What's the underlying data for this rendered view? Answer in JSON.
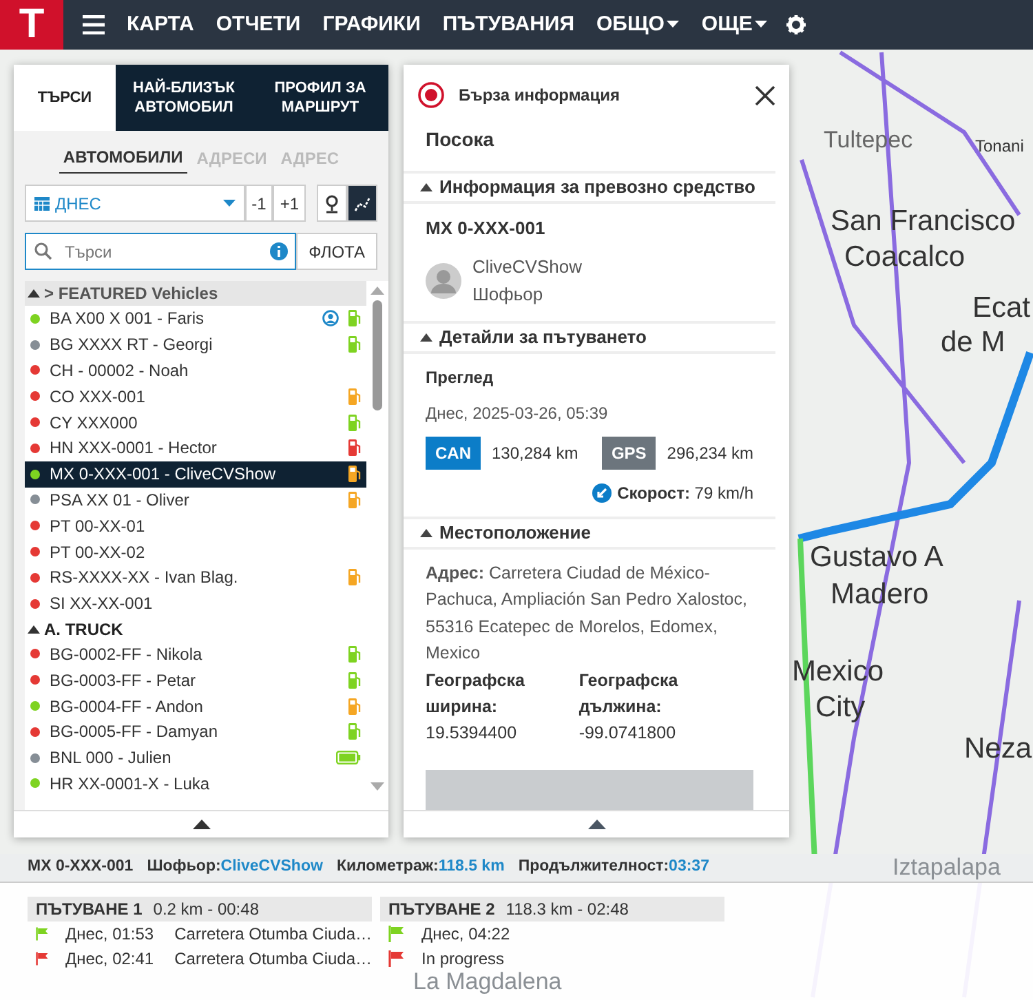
{
  "navbar": {
    "logo": "T",
    "menu": [
      {
        "label": "КАРТА",
        "dropdown": false
      },
      {
        "label": "ОТЧЕТИ",
        "dropdown": false
      },
      {
        "label": "ГРАФИКИ",
        "dropdown": false
      },
      {
        "label": "ПЪТУВАНИЯ",
        "dropdown": false
      },
      {
        "label": "ОБЩО",
        "dropdown": true
      },
      {
        "label": "ОЩЕ",
        "dropdown": true
      }
    ]
  },
  "map": {
    "labels": [
      "Tultepec",
      "Tonani",
      "San Francisco",
      "Coacalco",
      "Ecat",
      "de M",
      "Gustavo A",
      "Madero",
      "Mexico",
      "City",
      "Neza",
      "Iztapalapa",
      "La Magdalena"
    ]
  },
  "left_panel": {
    "tabs": [
      {
        "label": "ТЪРСИ",
        "selected": true
      },
      {
        "label": "НАЙ-БЛИЗЪК АВТОМОБИЛ",
        "selected": false
      },
      {
        "label": "ПРОФИЛ ЗА МАРШРУТ",
        "selected": false
      }
    ],
    "subtabs": [
      {
        "label": "АВТОМОБИЛИ",
        "selected": true
      },
      {
        "label": "АДРЕСИ",
        "selected": false
      },
      {
        "label": "АДРЕС",
        "selected": false
      }
    ],
    "date": {
      "value": "ДНЕС",
      "minus": "-1",
      "plus": "+1"
    },
    "route_toggle": {
      "on": true
    },
    "search": {
      "placeholder": "Търси",
      "fleet_button": "ФЛОТА"
    },
    "groups": [
      {
        "title": "> FEATURED Vehicles",
        "expanded": true,
        "vehicles": [
          {
            "name": "BA X00 X 001 - Faris",
            "color": "#7ed321",
            "selected": false,
            "badges": [
              {
                "kind": "driver",
                "color": "#1e88c8"
              },
              {
                "kind": "fuel",
                "color": "#7ed321"
              }
            ]
          },
          {
            "name": "BG XXXX RT - Georgi",
            "color": "#868e96",
            "selected": false,
            "badges": [
              {
                "kind": "fuel",
                "color": "#7ed321"
              }
            ]
          },
          {
            "name": "CH - 00002 - Noah",
            "color": "#e53935",
            "selected": false
          },
          {
            "name": "CO XXX-001",
            "color": "#e53935",
            "selected": false,
            "badges": [
              {
                "kind": "fuel",
                "color": "#f5a623"
              }
            ]
          },
          {
            "name": "CY XXX000",
            "color": "#e53935",
            "selected": false,
            "badges": [
              {
                "kind": "fuel",
                "color": "#7ed321"
              }
            ]
          },
          {
            "name": "HN XXX-0001 - Hector",
            "color": "#e53935",
            "selected": false,
            "badges": [
              {
                "kind": "fuel",
                "color": "#e53935"
              }
            ]
          },
          {
            "name": "MX 0-XXX-001 - CliveCVShow",
            "color": "#7ed321",
            "selected": true,
            "badges": [
              {
                "kind": "fuel",
                "color": "#f5a623"
              }
            ]
          },
          {
            "name": "PSA XX 01 - Oliver",
            "color": "#868e96",
            "selected": false,
            "badges": [
              {
                "kind": "fuel",
                "color": "#f5a623"
              }
            ]
          },
          {
            "name": "PT 00-XX-01",
            "color": "#e53935",
            "selected": false
          },
          {
            "name": "PT 00-XX-02",
            "color": "#e53935",
            "selected": false
          },
          {
            "name": "RS-XXXX-XX - Ivan Blag.",
            "color": "#e53935",
            "selected": false,
            "badges": [
              {
                "kind": "fuel",
                "color": "#f5a623"
              }
            ]
          },
          {
            "name": "SI XX-XX-001",
            "color": "#e53935",
            "selected": false
          }
        ]
      },
      {
        "title": "A. TRUCK",
        "expanded": true,
        "vehicles": [
          {
            "name": "BG-0002-FF - Nikola",
            "color": "#e53935",
            "selected": false,
            "badges": [
              {
                "kind": "fuel",
                "color": "#7ed321"
              }
            ]
          },
          {
            "name": "BG-0003-FF - Petar",
            "color": "#e53935",
            "selected": false,
            "badges": [
              {
                "kind": "fuel",
                "color": "#7ed321"
              }
            ]
          },
          {
            "name": "BG-0004-FF - Andon",
            "color": "#7ed321",
            "selected": false,
            "badges": [
              {
                "kind": "fuel",
                "color": "#f5a623"
              }
            ]
          },
          {
            "name": "BG-0005-FF - Damyan",
            "color": "#e53935",
            "selected": false,
            "badges": [
              {
                "kind": "fuel",
                "color": "#7ed321"
              }
            ]
          },
          {
            "name": "BNL 000 - Julien",
            "color": "#868e96",
            "selected": false,
            "badges": [
              {
                "kind": "battery",
                "color": "#7ed321"
              }
            ]
          },
          {
            "name": "HR XX-0001-X - Luka",
            "color": "#7ed321",
            "selected": false
          }
        ]
      }
    ]
  },
  "info_panel": {
    "title": "Бърза информация",
    "direction": "Посока",
    "vehicle_section": {
      "title": "Информация за превозно средство",
      "expanded": true,
      "plate": "MX 0-XXX-001",
      "driver": "CliveCVShow",
      "role": "Шофьор"
    },
    "trip_section": {
      "title": "Детайли за пътуването",
      "expanded": true,
      "overview": "Преглед",
      "date": "Днес, 2025-03-26, 05:39",
      "can_label": "CAN",
      "can_value": "130,284 km",
      "gps_label": "GPS",
      "gps_value": "296,234 km",
      "speed": "**Скорост:** 79 km/h"
    },
    "location_section": {
      "title": "Местоположение",
      "expanded": true,
      "address": "**Адрес:** Carretera Ciudad de México-Pachuca, Ampliación San Pedro Xalostoc, 55316 Ecatepec de Morelos, Edomex, Mexico",
      "lat_label": "Географска ширина:",
      "lat": "19.5394400",
      "lon_label": "Географска дължина:",
      "lon": "-99.0741800"
    }
  },
  "status_bar": {
    "plate": "MX 0-XXX-001",
    "driver_label": "Шофьор:",
    "driver": "CliveCVShow",
    "mileage_label": "Километраж:",
    "mileage": "118.5 km",
    "duration_label": "Продължителност:",
    "duration": "03:37"
  },
  "trips": [
    {
      "title": "ПЪТУВАНЕ 1",
      "summary": "0.2 km - 00:48",
      "rows": [
        {
          "kind": "start",
          "time": "Днес, 01:53",
          "place": "Carretera Otumba Ciuda…"
        },
        {
          "kind": "end",
          "time": "Днес, 02:41",
          "place": "Carretera Otumba Ciuda…"
        }
      ]
    },
    {
      "title": "ПЪТУВАНЕ 2",
      "summary": "118.3 km - 02:48",
      "rows": [
        {
          "kind": "start",
          "time": "Днес, 04:22"
        },
        {
          "kind": "end",
          "status": "In progress"
        }
      ]
    }
  ]
}
